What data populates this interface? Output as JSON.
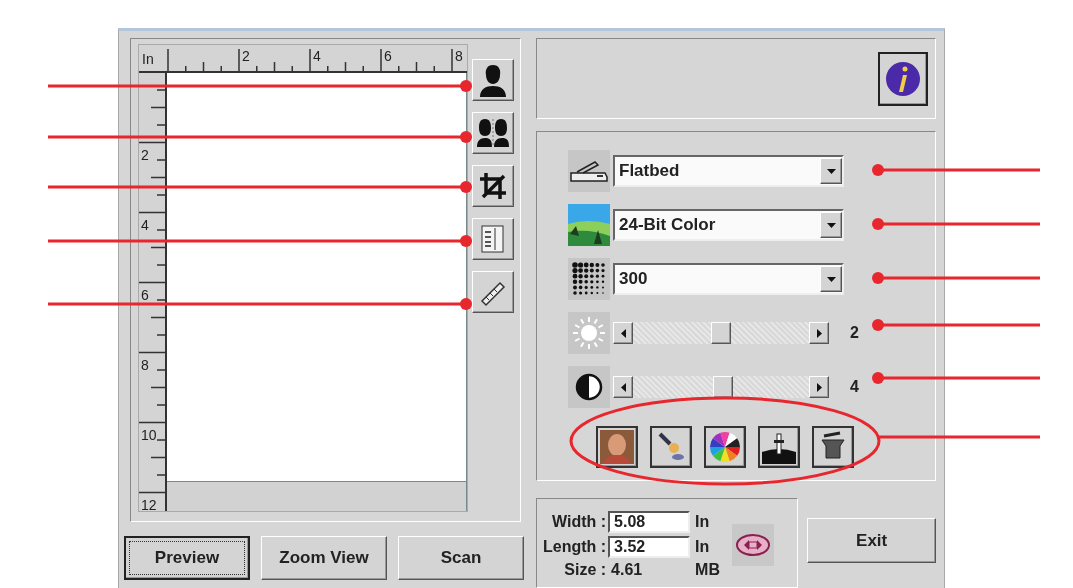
{
  "preview_panel": {
    "unit_label": "In",
    "top_ruler_labels": [
      "2",
      "4",
      "6",
      "8"
    ],
    "left_ruler_labels": [
      "2",
      "4",
      "6",
      "8",
      "10",
      "12"
    ]
  },
  "buttons": [
    {
      "label": "Preview",
      "focused": true
    },
    {
      "label": "Zoom View",
      "focused": false
    },
    {
      "label": "Scan",
      "focused": false
    }
  ],
  "settings": {
    "dropdowns": [
      {
        "kind": "source",
        "value": "Flatbed"
      },
      {
        "kind": "color",
        "value": "24-Bit Color"
      },
      {
        "kind": "resolution",
        "value": "300"
      }
    ],
    "sliders": [
      {
        "kind": "brightness",
        "level": 0.5,
        "reading": "2"
      },
      {
        "kind": "contrast",
        "level": 0.51,
        "reading": "4"
      }
    ]
  },
  "size_info": {
    "rows": [
      {
        "label": "Width :",
        "value": "5.08",
        "unit": "In",
        "kind": "field"
      },
      {
        "label": "Length :",
        "value": "3.52",
        "unit": "In",
        "kind": "field"
      },
      {
        "label": "Size :",
        "value": "4.61",
        "unit": "MB",
        "kind": "text"
      }
    ]
  },
  "exit_button": "Exit"
}
